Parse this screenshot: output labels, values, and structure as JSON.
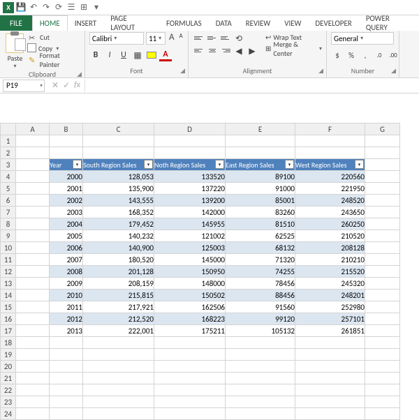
{
  "qat": {
    "save": "💾",
    "undo": "↶",
    "redo": "↷"
  },
  "tabs": {
    "file": "FILE",
    "home": "HOME",
    "insert": "INSERT",
    "pagelayout": "PAGE LAYOUT",
    "formulas": "FORMULAS",
    "data": "DATA",
    "review": "REVIEW",
    "view": "VIEW",
    "developer": "DEVELOPER",
    "powerquery": "POWER QUERY"
  },
  "ribbon": {
    "clipboard": {
      "paste": "Paste",
      "cut": "Cut",
      "copy": "Copy",
      "painter": "Format Painter",
      "label": "Clipboard"
    },
    "font": {
      "name": "Calibri",
      "size": "11",
      "label": "Font",
      "bold": "B",
      "italic": "I",
      "underline": "U",
      "color": "A"
    },
    "alignment": {
      "label": "Alignment",
      "wrap": "Wrap Text",
      "merge": "Merge & Center"
    },
    "number": {
      "label": "Number",
      "format": "General",
      "currency": "$",
      "percent": "%",
      "comma": ",",
      "inc": ".0",
      "dec": ".00"
    }
  },
  "namebox": "P19",
  "fx": {
    "cancel": "✕",
    "enter": "✓",
    "fx": "fx"
  },
  "columns": [
    "A",
    "B",
    "C",
    "D",
    "E",
    "F",
    "G"
  ],
  "table": {
    "headers": [
      "Year",
      "South Region Sales",
      "Noth Region Sales",
      "East Region Sales",
      "West Region Sales"
    ],
    "rows": [
      [
        "2000",
        "128,053",
        "133520",
        "89100",
        "220560"
      ],
      [
        "2001",
        "135,900",
        "137220",
        "91000",
        "221950"
      ],
      [
        "2002",
        "143,555",
        "139200",
        "85001",
        "248520"
      ],
      [
        "2003",
        "168,352",
        "142000",
        "83260",
        "243650"
      ],
      [
        "2004",
        "179,452",
        "145955",
        "81510",
        "260250"
      ],
      [
        "2005",
        "140,232",
        "121002",
        "62525",
        "210520"
      ],
      [
        "2006",
        "140,900",
        "125003",
        "68132",
        "208128"
      ],
      [
        "2007",
        "180,520",
        "145000",
        "71320",
        "210210"
      ],
      [
        "2008",
        "201,128",
        "150950",
        "74255",
        "215520"
      ],
      [
        "2009",
        "208,159",
        "148000",
        "78456",
        "245320"
      ],
      [
        "2010",
        "215,815",
        "150502",
        "88456",
        "248201"
      ],
      [
        "2011",
        "217,921",
        "162506",
        "91560",
        "252980"
      ],
      [
        "2012",
        "212,520",
        "168223",
        "99120",
        "257101"
      ],
      [
        "2013",
        "222,001",
        "175211",
        "105132",
        "261851"
      ]
    ]
  },
  "rowcount": 24
}
